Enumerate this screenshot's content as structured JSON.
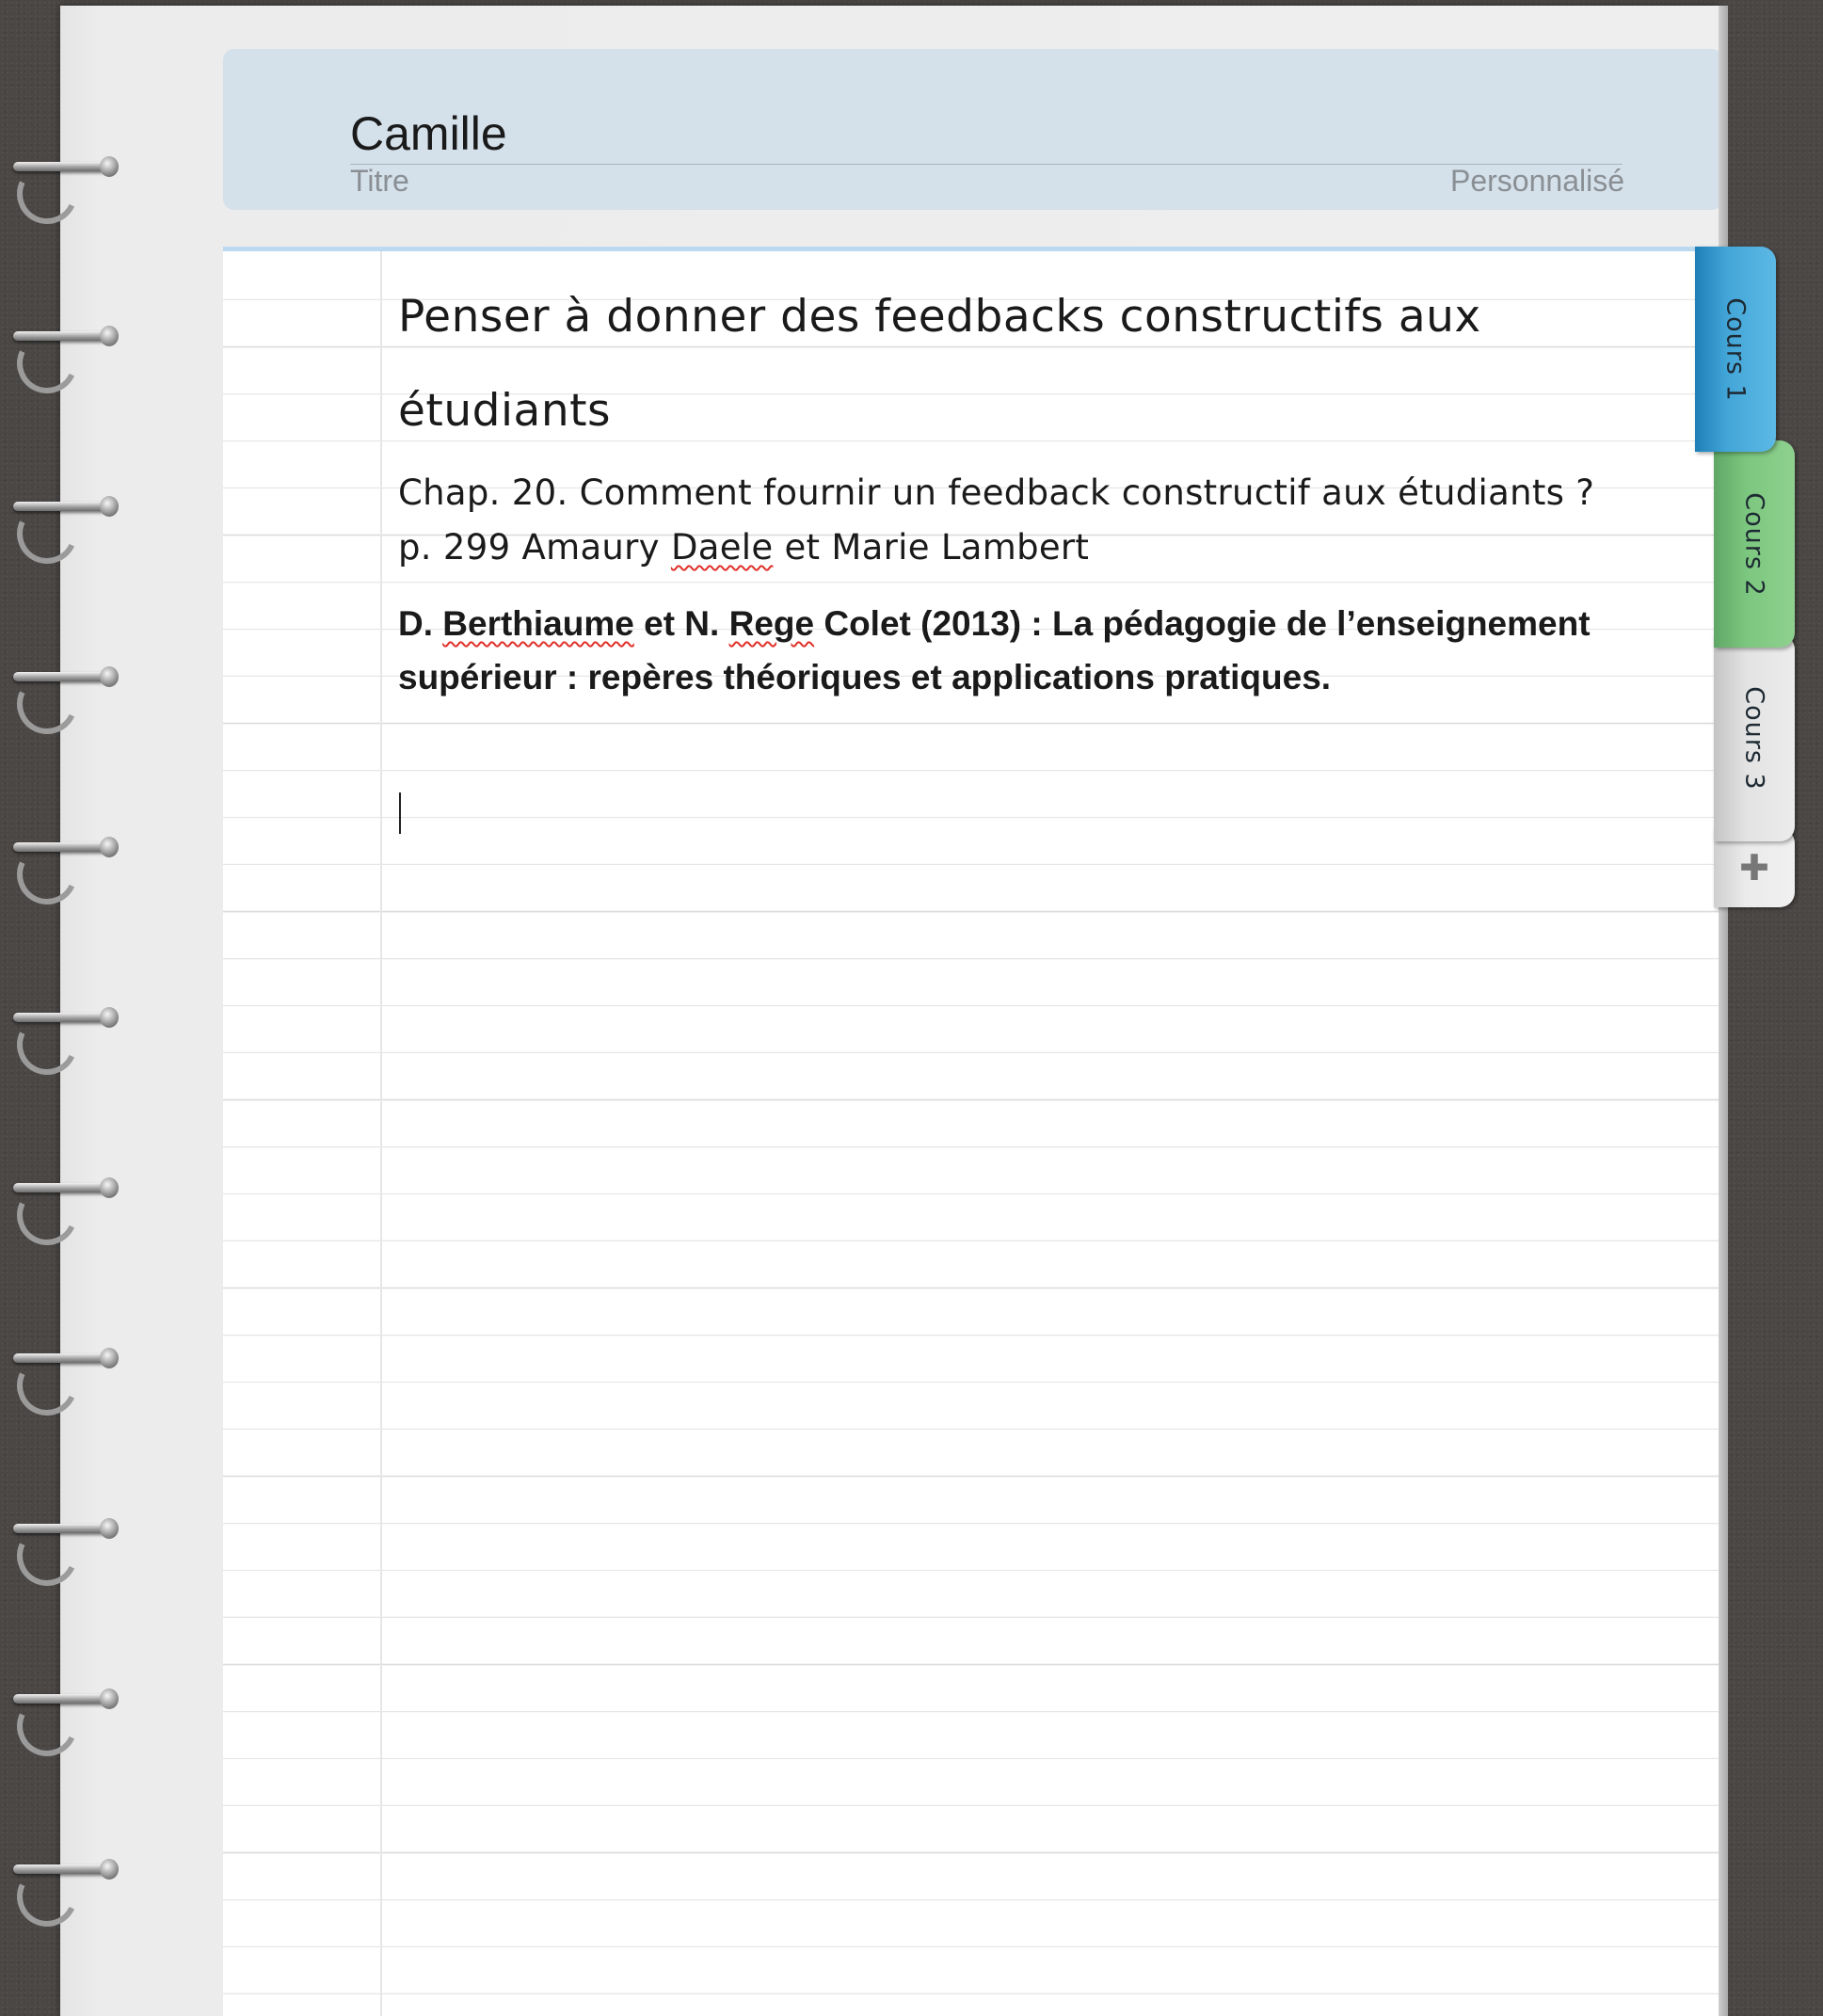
{
  "header": {
    "title_value": "Camille",
    "title_label": "Titre",
    "style_label": "Personnalisé"
  },
  "note": {
    "heading_line1": "Penser à donner des feedbacks constructifs aux",
    "heading_line2": "étudiants",
    "para1": {
      "before": "Chap. 20. Comment fournir un feedback constructif aux étudiants ? p. 299 Amaury ",
      "misspelled": "Daele",
      "after": " et Marie Lambert"
    },
    "para2": {
      "part1": "D. ",
      "misspelled1": "Berthiaume",
      "part2": " et N. ",
      "misspelled2": "Rege",
      "part3": " Colet  (2013) : La pédagogie de l’enseignement supérieur : repères théoriques et applications pratiques."
    }
  },
  "tabs": [
    {
      "label": "Cours 1",
      "color": "#43a6d8",
      "active": true
    },
    {
      "label": "Cours 2",
      "color": "#7cc77f",
      "active": false
    },
    {
      "label": "Cours 3",
      "color": "#e3e3e3",
      "active": false
    }
  ],
  "add_tab_icon": "plus-icon",
  "colors": {
    "background": "#4a4745",
    "header_bg": "#d4e0ea",
    "page_rule": "#dcdcdc",
    "spellcheck": "#e0312a"
  }
}
